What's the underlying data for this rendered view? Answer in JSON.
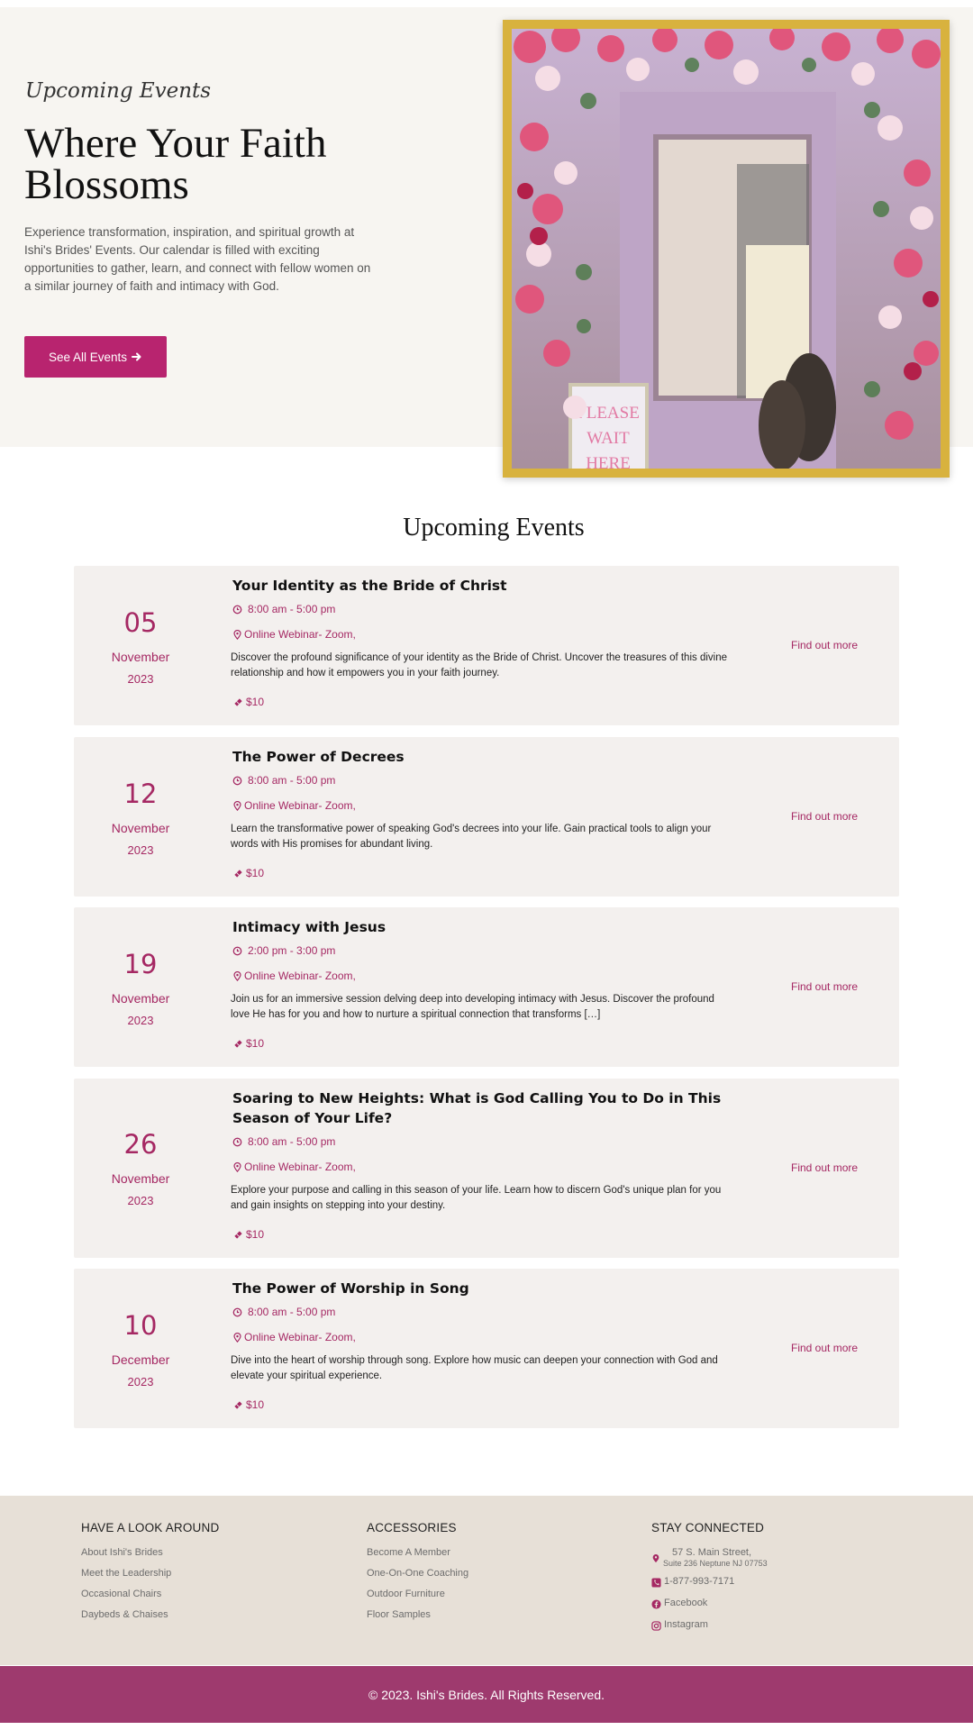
{
  "hero": {
    "kicker": "Upcoming Events",
    "title": "Where Your Faith Blossoms",
    "description": "Experience transformation, inspiration, and spiritual growth at Ishi's Brides' Events. Our calendar is filled with exciting opportunities to gather, learn, and connect with fellow women on a similar journey of faith and intimacy with God.",
    "button_label": "See All Events",
    "button_icon": "arrow-right-icon",
    "image_sign_text": "PLEASE WAIT HERE"
  },
  "events_section": {
    "title": "Upcoming Events",
    "link_label": "Find out more",
    "events": [
      {
        "day": "05",
        "month": "November",
        "year": "2023",
        "title": "Your Identity as the Bride of Christ",
        "time": "8:00 am - 5:00 pm",
        "location": "Online Webinar- Zoom,",
        "description": "Discover the profound significance of your identity as the Bride of Christ. Uncover the treasures of this divine relationship and how it empowers you in your faith journey.",
        "price": "$10"
      },
      {
        "day": "12",
        "month": "November",
        "year": "2023",
        "title": "The Power of Decrees",
        "time": "8:00 am - 5:00 pm",
        "location": "Online Webinar- Zoom,",
        "description": "Learn the transformative power of speaking God's decrees into your life. Gain practical tools to align your words with His promises for abundant living.",
        "price": "$10"
      },
      {
        "day": "19",
        "month": "November",
        "year": "2023",
        "title": "Intimacy with Jesus",
        "time": "2:00 pm - 3:00 pm",
        "location": "Online Webinar- Zoom,",
        "description": "Join us for an immersive session delving deep into developing intimacy with Jesus. Discover the profound love He has for you and how to nurture a spiritual connection that transforms […]",
        "price": "$10"
      },
      {
        "day": "26",
        "month": "November",
        "year": "2023",
        "title": "Soaring to New Heights: What is God Calling You to Do in This Season of Your Life?",
        "time": "8:00 am - 5:00 pm",
        "location": "Online Webinar- Zoom,",
        "description": "Explore your purpose and calling in this season of your life. Learn how to discern God's unique plan for you and gain insights on stepping into your destiny.",
        "price": "$10"
      },
      {
        "day": "10",
        "month": "December",
        "year": "2023",
        "title": "The Power of Worship in Song",
        "time": "8:00 am - 5:00 pm",
        "location": "Online Webinar- Zoom,",
        "description": "Dive into the heart of worship through song. Explore how music can deepen your connection with God and elevate your spiritual experience.",
        "price": "$10"
      }
    ]
  },
  "footer": {
    "col1": {
      "heading": "HAVE A LOOK AROUND",
      "links": [
        "About Ishi's Brides",
        "Meet the Leadership",
        "Occasional Chairs",
        "Daybeds & Chaises"
      ]
    },
    "col2": {
      "heading": "ACCESSORIES",
      "links": [
        "Become A Member",
        "One-On-One Coaching",
        "Outdoor Furniture",
        "Floor Samples"
      ]
    },
    "col3": {
      "heading": "STAY CONNECTED",
      "address_line1": "57 S. Main Street,",
      "address_line2": "Suite 236 Neptune NJ 07753",
      "phone": "1-877-993-7171",
      "facebook": "Facebook",
      "instagram": "Instagram"
    },
    "copyright": "© 2023. Ishi's Brides. All Rights Reserved."
  },
  "colors": {
    "accent": "#b8246f",
    "date_text": "#a52863",
    "footer_bar": "#9e3a6e",
    "frame_gold": "#d8b23e",
    "card_bg": "#f3f0ee"
  }
}
